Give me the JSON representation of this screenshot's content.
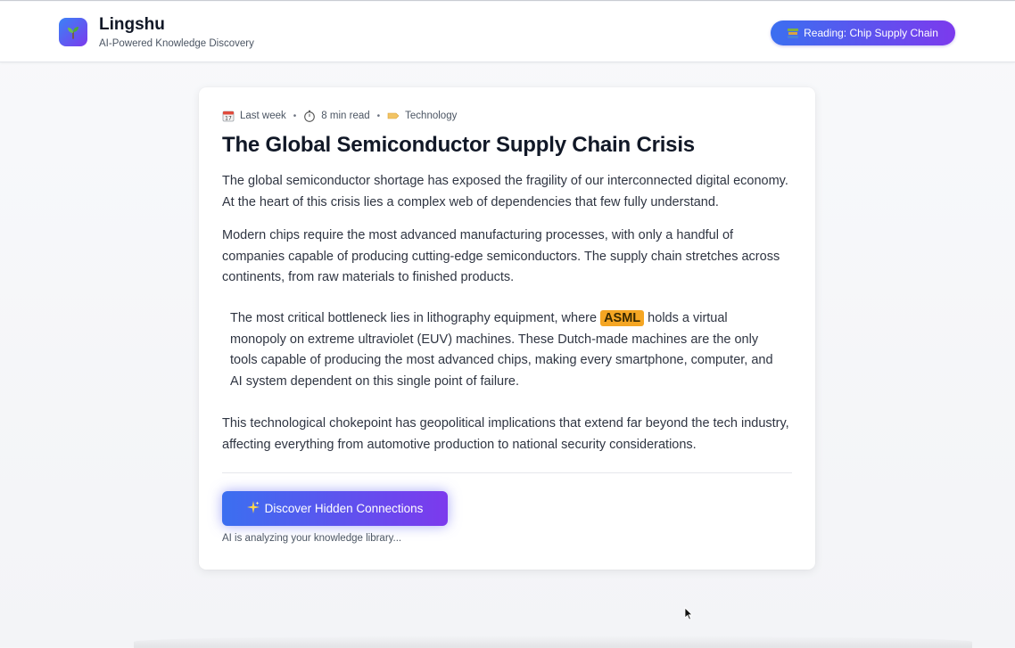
{
  "header": {
    "app_name": "Lingshu",
    "tagline": "AI-Powered Knowledge Discovery",
    "logo_icon": "seedling-icon",
    "reading_label": "Reading: Chip Supply Chain",
    "reading_icon": "books-icon"
  },
  "article": {
    "meta": {
      "date": "Last week",
      "date_icon": "calendar-icon",
      "read_time": "8 min read",
      "read_time_icon": "stopwatch-icon",
      "category": "Technology",
      "category_icon": "tag-icon",
      "separator": "•"
    },
    "title": "The Global Semiconductor Supply Chain Crisis",
    "paragraphs": {
      "p1": "The global semiconductor shortage has exposed the fragility of our interconnected digital economy. At the heart of this crisis lies a complex web of dependencies that few fully understand.",
      "p2": "Modern chips require the most advanced manufacturing processes, with only a handful of companies capable of producing cutting-edge semiconductors. The supply chain stretches across continents, from raw materials to finished products.",
      "p3_before": "The most critical bottleneck lies in lithography equipment, where ",
      "p3_highlight": "ASML",
      "p3_after": " holds a virtual monopoly on extreme ultraviolet (EUV) machines. These Dutch-made machines are the only tools capable of producing the most advanced chips, making every smartphone, computer, and AI system dependent on this single point of failure.",
      "p4": "This technological chokepoint has geopolitical implications that extend far beyond the tech industry, affecting everything from automotive production to national security considerations."
    },
    "highlight_color": "#f5a623"
  },
  "actions": {
    "discover_label": "Discover Hidden Connections",
    "discover_icon": "sparkles-icon",
    "status": "AI is analyzing your knowledge library..."
  },
  "colors": {
    "accent_start": "#3b6ff0",
    "accent_end": "#7c3aed"
  }
}
